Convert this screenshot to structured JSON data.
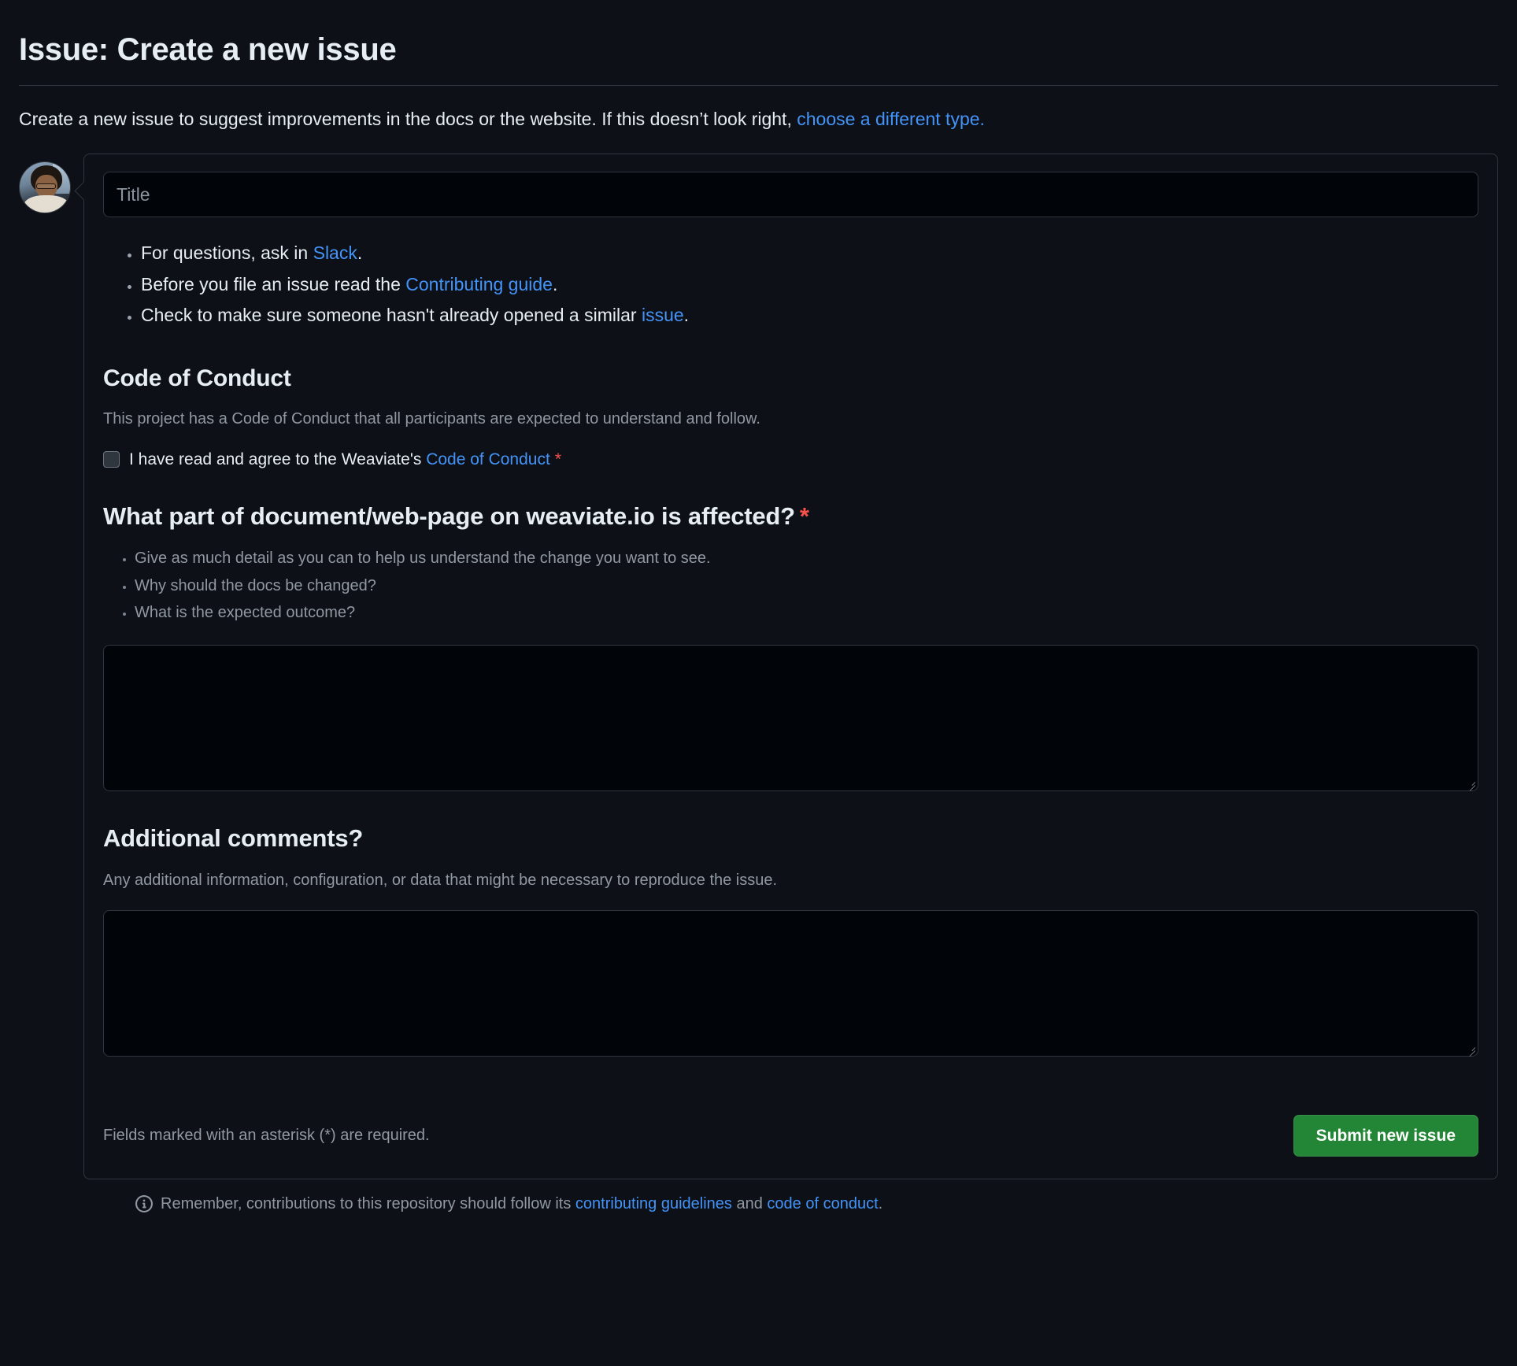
{
  "page": {
    "title": "Issue: Create a new issue",
    "description_before": "Create a new issue to suggest improvements in the docs or the website. If this doesn’t look right, ",
    "description_link": "choose a different type.",
    "description_after": ""
  },
  "composer": {
    "avatar_name": "user-avatar",
    "title_input": {
      "placeholder": "Title",
      "value": ""
    }
  },
  "intro_bullets": [
    {
      "before": "For questions, ask in ",
      "link": "Slack",
      "after": "."
    },
    {
      "before": "Before you file an issue read the ",
      "link": "Contributing guide",
      "after": "."
    },
    {
      "before": "Check to make sure someone hasn't already opened a similar ",
      "link": "issue",
      "after": "."
    }
  ],
  "code_of_conduct": {
    "heading": "Code of Conduct",
    "description": "This project has a Code of Conduct that all participants are expected to understand and follow.",
    "checkbox": {
      "checked": false,
      "label_before": "I have read and agree to the Weaviate's ",
      "label_link": "Code of Conduct",
      "required_marker": "*"
    }
  },
  "affected_section": {
    "heading": "What part of document/web-page on weaviate.io is affected?",
    "required_marker": "*",
    "bullets": [
      "Give as much detail as you can to help us understand the change you want to see.",
      "Why should the docs be changed?",
      "What is the expected outcome?"
    ],
    "textarea": {
      "value": "",
      "placeholder": ""
    }
  },
  "additional_section": {
    "heading": "Additional comments?",
    "description": "Any additional information, configuration, or data that might be necessary to reproduce the issue.",
    "textarea": {
      "value": "",
      "placeholder": ""
    }
  },
  "footer": {
    "required_note": "Fields marked with an asterisk (*) are required.",
    "submit_label": "Submit new issue"
  },
  "repo_note": {
    "before": "Remember, contributions to this repository should follow its ",
    "link1": "contributing guidelines",
    "middle": " and ",
    "link2": "code of conduct",
    "after": "."
  },
  "colors": {
    "background": "#0d1117",
    "field_background": "#010409",
    "border": "#30363d",
    "text": "#e6edf3",
    "muted_text": "#9198a1",
    "link": "#4493f8",
    "required": "#f85149",
    "submit_green": "#238636"
  }
}
